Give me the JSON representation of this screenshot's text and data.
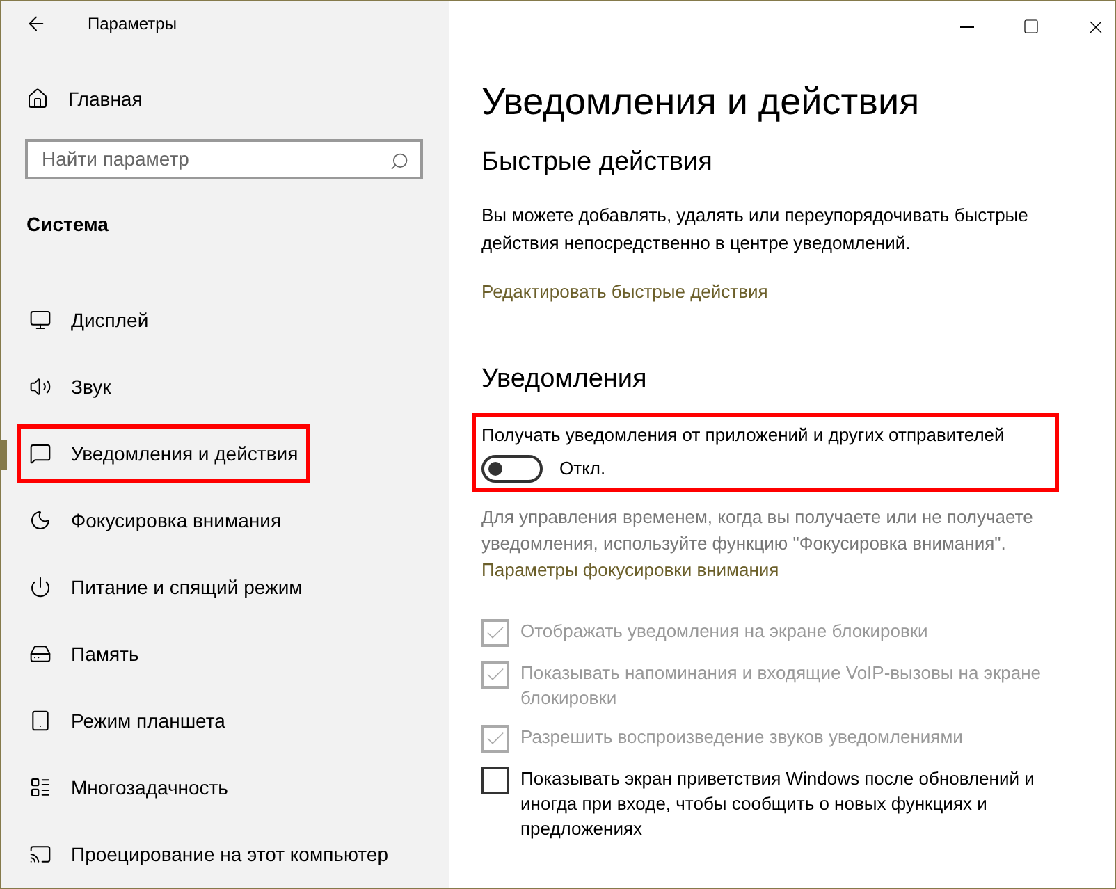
{
  "window": {
    "title": "Параметры"
  },
  "sidebar": {
    "home": "Главная",
    "search": {
      "placeholder": "Найти параметр"
    },
    "section": "Система",
    "items": [
      {
        "label": "Дисплей",
        "selected": false,
        "highlighted": false
      },
      {
        "label": "Звук",
        "selected": false,
        "highlighted": false
      },
      {
        "label": "Уведомления и действия",
        "selected": true,
        "highlighted": true
      },
      {
        "label": "Фокусировка внимания",
        "selected": false,
        "highlighted": false
      },
      {
        "label": "Питание и спящий режим",
        "selected": false,
        "highlighted": false
      },
      {
        "label": "Память",
        "selected": false,
        "highlighted": false
      },
      {
        "label": "Режим планшета",
        "selected": false,
        "highlighted": false
      },
      {
        "label": "Многозадачность",
        "selected": false,
        "highlighted": false
      },
      {
        "label": "Проецирование на этот компьютер",
        "selected": false,
        "highlighted": false
      }
    ]
  },
  "page": {
    "title": "Уведомления и действия",
    "quick_actions": {
      "heading": "Быстрые действия",
      "description": "Вы можете добавлять, удалять или переупорядочивать быстрые действия непосредственно в центре уведомлений.",
      "link": "Редактировать быстрые действия"
    },
    "notifications": {
      "heading": "Уведомления",
      "toggle": {
        "label": "Получать уведомления от приложений и других отправителей",
        "on": false,
        "state_text": "Откл.",
        "highlighted": true
      },
      "description": "Для управления временем, когда вы получаете или не получаете уведомления, используйте функцию \"Фокусировка внимания\".",
      "link": "Параметры фокусировки внимания",
      "options": [
        {
          "label": "Отображать уведомления на экране блокировки",
          "checked": true,
          "disabled": true
        },
        {
          "label": "Показывать напоминания и входящие VoIP-вызовы на экране блокировки",
          "checked": true,
          "disabled": true
        },
        {
          "label": "Разрешить  воспроизведение звуков уведомлениями",
          "checked": true,
          "disabled": true
        },
        {
          "label": "Показывать экран приветствия Windows после обновлений и иногда при входе, чтобы сообщить о новых функциях и предложениях",
          "checked": false,
          "disabled": false
        }
      ]
    }
  }
}
